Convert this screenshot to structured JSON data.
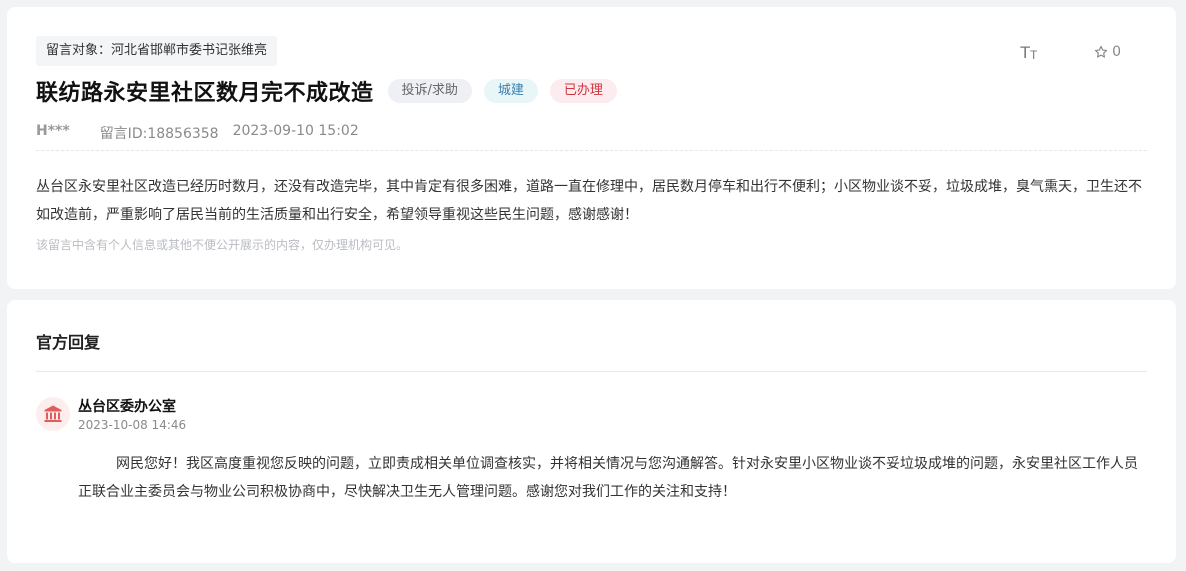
{
  "message": {
    "target_label": "留言对象：河北省邯郸市委书记张维亮",
    "title": "联纺路永安里社区数月完不成改造",
    "tags": [
      "投诉/求助",
      "城建",
      "已办理"
    ],
    "author": "H***",
    "message_id": "留言ID:18856358",
    "datetime": "2023-09-10 15:02",
    "favorites": "0",
    "content": "丛台区永安里社区改造已经历时数月，还没有改造完毕，其中肯定有很多困难，道路一直在修理中，居民数月停车和出行不便利；小区物业谈不妥，垃圾成堆，臭气熏天，卫生还不如改造前，严重影响了居民当前的生活质量和出行安全，希望领导重视这些民生问题，感谢感谢！",
    "notice": "该留言中含有个人信息或其他不便公开展示的内容，仅办理机构可见。"
  },
  "reply": {
    "heading": "官方回复",
    "org_name": "丛台区委办公室",
    "date": "2023-10-08 14:46",
    "text": "网民您好！我区高度重视您反映的问题，立即责成相关单位调查核实，并将相关情况与您沟通解答。针对永安里小区物业谈不妥垃圾成堆的问题，永安里社区工作人员正联合业主委员会与物业公司积极协商中，尽快解决卫生无人管理问题。感谢您对我们工作的关注和支持！"
  },
  "icons": {
    "font_size": "font-size-icon",
    "favorite": "star-icon",
    "org": "government-building-icon"
  },
  "colors": {
    "page_bg": "#f2f3f5",
    "tag_red_text": "#d0353d",
    "tag_teal_text": "#3a7fb0",
    "avatar_bg": "#fdeeee",
    "avatar_icon": "#e35b5b"
  }
}
